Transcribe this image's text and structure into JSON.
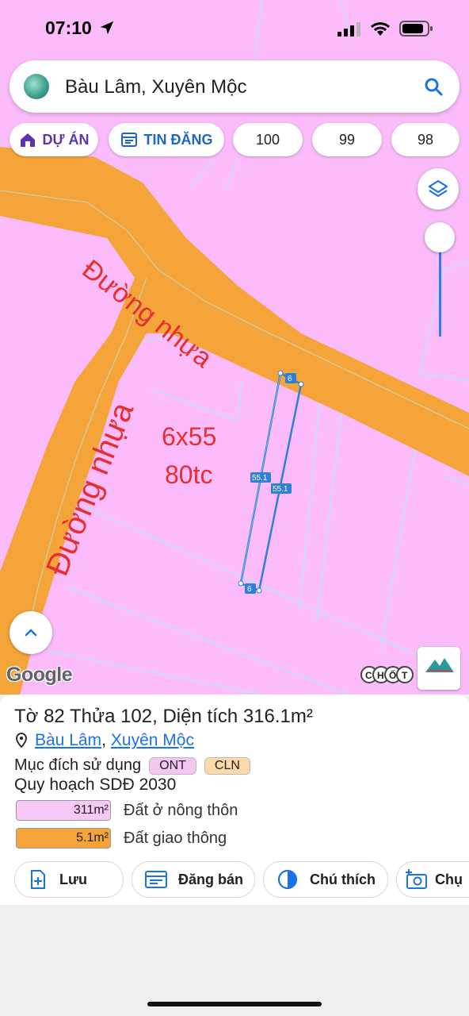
{
  "status_bar": {
    "time": "07:10"
  },
  "search": {
    "query": "Bàu Lâm, Xuyên Mộc"
  },
  "chips": [
    {
      "label": "DỰ ÁN",
      "icon": "house-icon"
    },
    {
      "label": "TIN ĐĂNG",
      "icon": "listing-icon"
    },
    {
      "label": "100"
    },
    {
      "label": "99"
    },
    {
      "label": "98"
    }
  ],
  "map": {
    "road_label_1": "Đường nhựa",
    "road_label_2": "Đường nhựa",
    "plot_size": "6x55",
    "plot_note": "80tc",
    "dim_top": "6",
    "dim_bottom": "6",
    "dim_left": "55.1",
    "dim_right": "55.1",
    "attribution": "Google",
    "watermark": "CHỐT",
    "colors": {
      "land": "#fcbcfc",
      "road": "#f5a43a",
      "boundary": "#2f7fd8",
      "annotation": "#e5302f"
    }
  },
  "parcel": {
    "title": "Tờ 82 Thửa 102, Diện tích 316.1m²",
    "ward": "Bàu Lâm",
    "district": "Xuyên Mộc",
    "purpose_label": "Mục đích sử dụng",
    "purpose_tags": [
      "ONT",
      "CLN"
    ],
    "plan_title": "Quy hoạch SDĐ 2030",
    "legend": [
      {
        "area": "311m²",
        "label": "Đất ở nông thôn",
        "color": "#f8c8f6"
      },
      {
        "area": "5.1m²",
        "label": "Đất giao thông",
        "color": "#f5a43a"
      }
    ]
  },
  "actions": [
    {
      "label": "Lưu",
      "icon": "save-plus-icon"
    },
    {
      "label": "Đăng bán",
      "icon": "post-listing-icon"
    },
    {
      "label": "Chú thích",
      "icon": "legend-contrast-icon"
    },
    {
      "label": "Chụ",
      "icon": "camera-plus-icon"
    }
  ]
}
